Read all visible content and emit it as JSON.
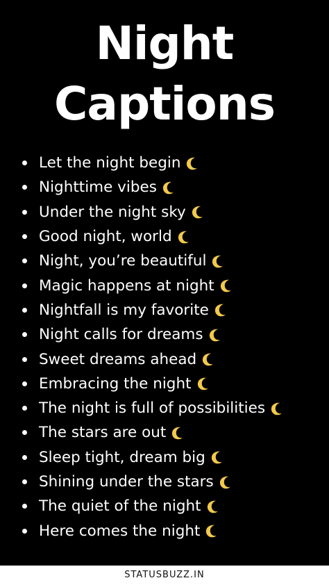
{
  "title": {
    "line1": "Night",
    "line2": "Captions"
  },
  "captions": [
    "Let the night begin",
    "Nighttime vibes",
    "Under the night sky",
    "Good night, world",
    "Night, you’re beautiful",
    "Magic happens at night",
    "Nightfall is my favorite",
    "Night calls for dreams",
    "Sweet dreams ahead",
    "Embracing the night",
    "The night is full of possibilities",
    "The stars are out",
    "Sleep tight, dream big",
    "Shining under the stars",
    "The quiet of the night",
    "Here comes the night"
  ],
  "icon": "crescent-moon-icon",
  "colors": {
    "background": "#000000",
    "text": "#ffffff",
    "moon": "#f2c94c",
    "footer_bg": "#ffffff",
    "footer_text": "#111111"
  },
  "footer": {
    "text": "STATUSBUZZ.IN"
  }
}
